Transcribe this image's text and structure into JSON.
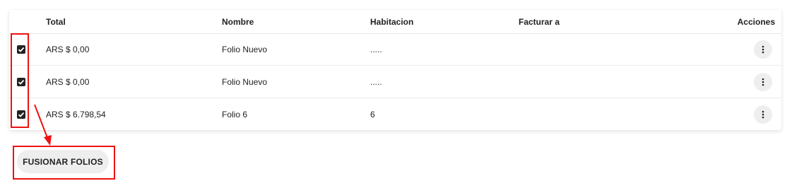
{
  "table": {
    "headers": {
      "total": "Total",
      "nombre": "Nombre",
      "habitacion": "Habitacion",
      "facturar_a": "Facturar a",
      "acciones": "Acciones"
    },
    "rows": [
      {
        "checked": true,
        "total": "ARS $ 0,00",
        "nombre": "Folio Nuevo",
        "habitacion": ".....",
        "facturar_a": ""
      },
      {
        "checked": true,
        "total": "ARS $ 0,00",
        "nombre": "Folio Nuevo",
        "habitacion": ".....",
        "facturar_a": ""
      },
      {
        "checked": true,
        "total": "ARS $ 6.798,54",
        "nombre": "Folio 6",
        "habitacion": "6",
        "facturar_a": ""
      }
    ]
  },
  "actions": {
    "merge_label": "FUSIONAR FOLIOS"
  },
  "icons": {
    "checkbox": "check-icon",
    "row_menu": "more-vertical-icon"
  },
  "colors": {
    "annotation": "#ee1111",
    "checkbox": "#222222",
    "button_bg": "#eeeeee"
  }
}
